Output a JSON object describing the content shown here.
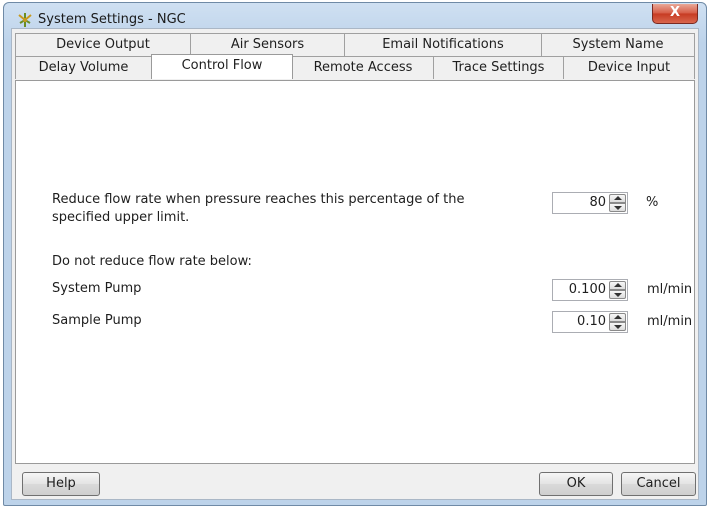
{
  "window": {
    "title": "System Settings - NGC",
    "close_glyph": "X",
    "app_icon": "ngc-app-icon"
  },
  "tabs": {
    "row_back": [
      {
        "label": "Device Output"
      },
      {
        "label": "Air Sensors"
      },
      {
        "label": "Email Notifications"
      },
      {
        "label": "System Name"
      }
    ],
    "row_front": [
      {
        "label": "Delay Volume"
      },
      {
        "label": "Control Flow"
      },
      {
        "label": "Remote Access"
      },
      {
        "label": "Trace Settings"
      },
      {
        "label": "Device Input"
      }
    ],
    "active": "Control Flow"
  },
  "panel": {
    "reduce_label_line1": "Reduce flow rate when pressure reaches this percentage of the",
    "reduce_label_line2": "specified upper limit.",
    "reduce_value": "80",
    "reduce_unit": "%",
    "min_heading": "Do not reduce flow rate below:",
    "system_pump_label": "System Pump",
    "system_pump_value": "0.100",
    "system_pump_unit": "ml/min",
    "sample_pump_label": "Sample Pump",
    "sample_pump_value": "0.10",
    "sample_pump_unit": "ml/min"
  },
  "buttons": {
    "help": "Help",
    "ok": "OK",
    "cancel": "Cancel"
  }
}
